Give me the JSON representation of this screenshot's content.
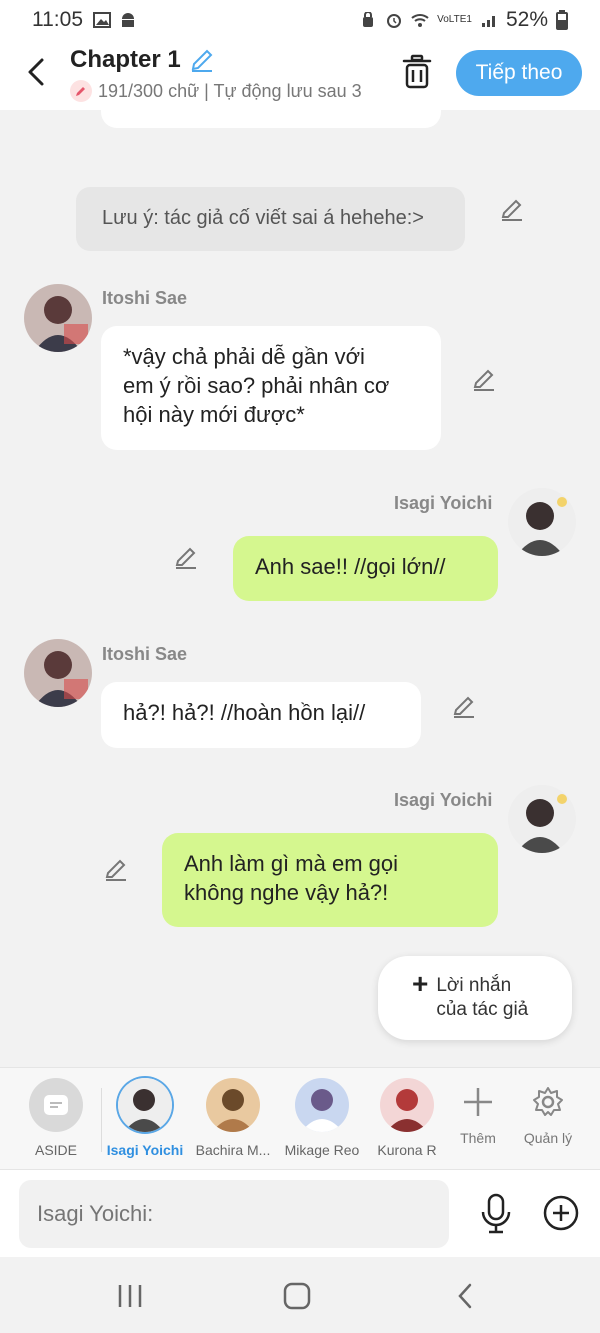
{
  "status_bar": {
    "time": "11:05",
    "battery": "52%",
    "network": "VoLTE1"
  },
  "header": {
    "title": "Chapter 1",
    "subtitle": "191/300 chữ | Tự động lưu sau 3",
    "next_label": "Tiếp theo"
  },
  "chat": {
    "note": "Lưu ý: tác giả cố viết sai á hehehe:>",
    "messages": [
      {
        "sender": "Itoshi Sae",
        "line1": "*vậy chả phải dễ gần với",
        "line2": "em ý rồi sao? phải nhân cơ",
        "line3": "hội này mới được*"
      },
      {
        "sender": "Isagi Yoichi",
        "text": "Anh sae!! //gọi lớn//"
      },
      {
        "sender": "Itoshi Sae",
        "text": "hả?! hả?! //hoàn hồn lại//"
      },
      {
        "sender": "Isagi Yoichi",
        "line1": "Anh làm gì mà em gọi",
        "line2": "không nghe vậy hả?!"
      }
    ],
    "author_note_button": {
      "line1": "Lời nhắn",
      "line2": "của tác giả"
    }
  },
  "characters": [
    {
      "label": "ASIDE"
    },
    {
      "label": "Isagi Yoichi"
    },
    {
      "label": "Bachira M..."
    },
    {
      "label": "Mikage Reo"
    },
    {
      "label": "Kurona R"
    }
  ],
  "tools": {
    "add_label": "Thêm",
    "manage_label": "Quản lý"
  },
  "input": {
    "placeholder": "Isagi Yoichi:"
  },
  "colors": {
    "accent": "#4ea9ee",
    "green_bubble": "#d5f78f",
    "active_char": "#2f8fe0"
  }
}
